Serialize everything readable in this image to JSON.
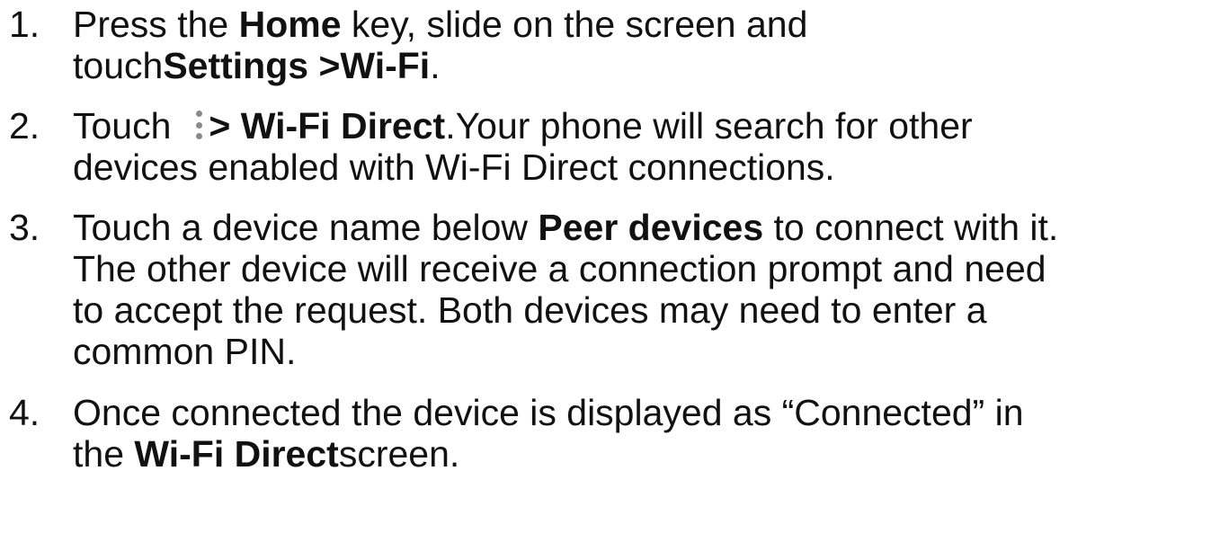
{
  "steps": [
    {
      "number": "1.",
      "lines": [
        {
          "t1": "Press the ",
          "b1": "Home",
          "t2": " key, slide on the screen and"
        },
        {
          "t1": "touch",
          "b1": "Settings >Wi-Fi",
          "t2": "."
        }
      ]
    },
    {
      "number": "2.",
      "icon": "more-options-icon",
      "lines": [
        {
          "t1": "Touch",
          "b1": "> Wi-Fi Direct",
          "t2": ".Your phone will search for other"
        },
        {
          "t1": "devices enabled with Wi-Fi Direct connections."
        }
      ]
    },
    {
      "number": "3.",
      "lines": [
        {
          "t1": "Touch a device name below ",
          "b1": "Peer devices",
          "t2": " to connect with it."
        },
        {
          "t1": "The other device will receive a connection prompt and need"
        },
        {
          "t1": "to accept the request. Both devices may need to enter a"
        },
        {
          "t1": "common PIN."
        }
      ]
    },
    {
      "number": "4.",
      "lines": [
        {
          "t1": "Once connected the device is displayed as “Connected” in"
        },
        {
          "t1": "the ",
          "b1": "Wi-Fi Direct",
          "t2": "screen."
        }
      ]
    }
  ]
}
